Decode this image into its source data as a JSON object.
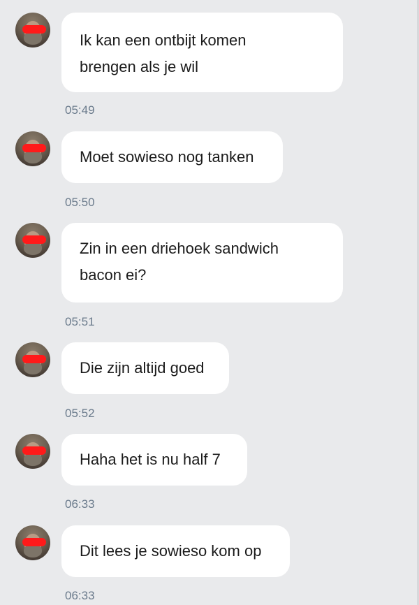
{
  "messages": [
    {
      "text": "Ik kan een ontbijt komen\nbrengen als je wil",
      "time": "05:49",
      "avatar_icon": "profile-photo-redacted"
    },
    {
      "text": "Moet sowieso nog tanken",
      "time": "05:50",
      "avatar_icon": "profile-photo-redacted"
    },
    {
      "text": "Zin in een driehoek sandwich\nbacon ei?",
      "time": "05:51",
      "avatar_icon": "profile-photo-redacted"
    },
    {
      "text": "Die zijn altijd goed",
      "time": "05:52",
      "avatar_icon": "profile-photo-redacted"
    },
    {
      "text": "Haha het is nu half 7",
      "time": "06:33",
      "avatar_icon": "profile-photo-redacted"
    },
    {
      "text": "Dit lees je sowieso kom op",
      "time": "06:33",
      "avatar_icon": "profile-photo-redacted"
    }
  ],
  "colors": {
    "background": "#e9eaec",
    "bubble": "#ffffff",
    "timestamp": "#6b7b8c",
    "redaction": "#ff1a1a"
  }
}
